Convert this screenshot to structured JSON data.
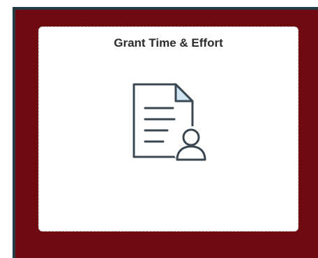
{
  "tile": {
    "title": "Grant Time & Effort",
    "icon": "document-person-icon"
  },
  "colors": {
    "panel_background": "#6f0a11",
    "outer_border": "#243a45",
    "tile_background": "#ffffff",
    "icon_stroke": "#3b4750",
    "icon_accent": "#cfe6f3"
  }
}
